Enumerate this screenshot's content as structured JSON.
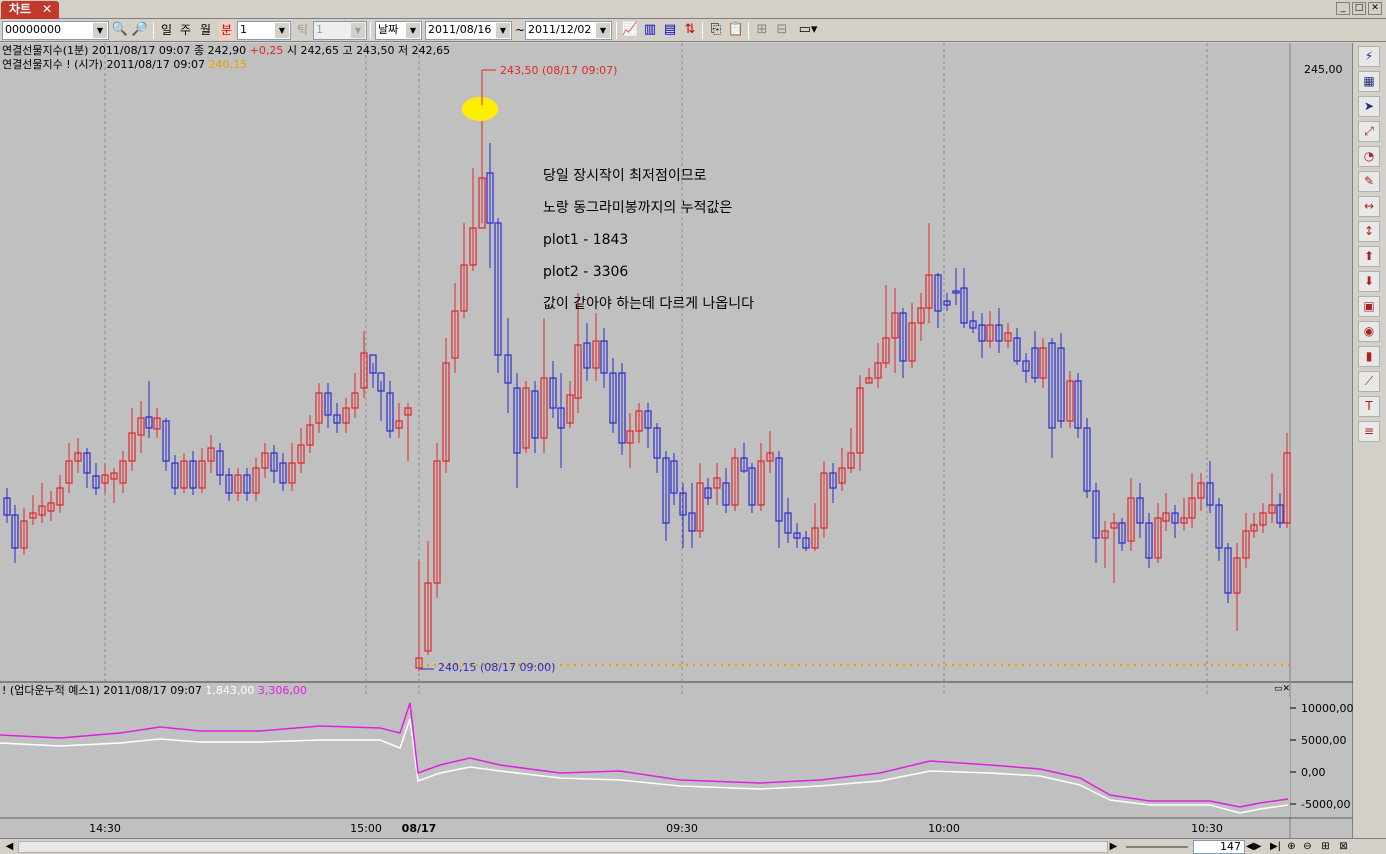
{
  "tab": {
    "label": "차트",
    "close": "✕"
  },
  "window_controls": [
    "_",
    "□",
    "✕"
  ],
  "toolbar": {
    "code_value": "00000000",
    "period_buttons": [
      "일",
      "주",
      "월",
      "분"
    ],
    "minute_value": "1",
    "tick_label": "틱",
    "tick_value": "1",
    "date_mode": "날짜",
    "start_date": "2011/08/16",
    "tilde": "~",
    "end_date": "2011/12/02"
  },
  "chart": {
    "header_line1": {
      "name": "연결선물지수(1분) 2011/08/17 09:07",
      "close_label": "종 242,90",
      "change": "+0,25",
      "ohl": "시 242,65 고 243,50 저 242,65"
    },
    "header_line2": {
      "name": "연결선물지수 ! (시가) 2011/08/17 09:07",
      "value": "240,15"
    },
    "high_marker": "243,50 (08/17 09:07)",
    "low_marker": "240,15 (08/17 09:00)",
    "price_axis_top": "245,00",
    "annotation": [
      "당일 장시작이 최저점이므로",
      "노랑 동그라미봉까지의 누적값은",
      "plot1 - 1843",
      "plot2 - 3306",
      "값이 같아야 하는데 다르게 나옵니다"
    ],
    "indicator_header": {
      "name": "! (업다운누적 예스1) 2011/08/17 09:07",
      "plot1": "1,843,00",
      "plot2": "3,306,00"
    },
    "indicator_axis": [
      "10000,00",
      "5000,00",
      "0,00",
      "-5000,00"
    ],
    "time_labels": [
      "14:30",
      "15:00",
      "08/17",
      "09:30",
      "10:00",
      "10:30"
    ],
    "colors": {
      "up": "#e0262a",
      "down": "#2a2ad0",
      "plot1": "#ffffff",
      "plot2": "#e020e0",
      "highlight": "#ffee00",
      "dotted": "#e8a000"
    }
  },
  "right_tools": [
    "refresh-icon",
    "grid-icon",
    "cursor-icon",
    "zoom-icon",
    "chart-icon",
    "pen-icon",
    "hline-icon",
    "vline-icon",
    "up-arrow-icon",
    "down-arrow-icon",
    "rect-icon",
    "circle-icon",
    "bars-icon",
    "trendline-icon",
    "text-icon",
    "fib-icon"
  ],
  "bottom": {
    "zoom_value": "147"
  }
}
